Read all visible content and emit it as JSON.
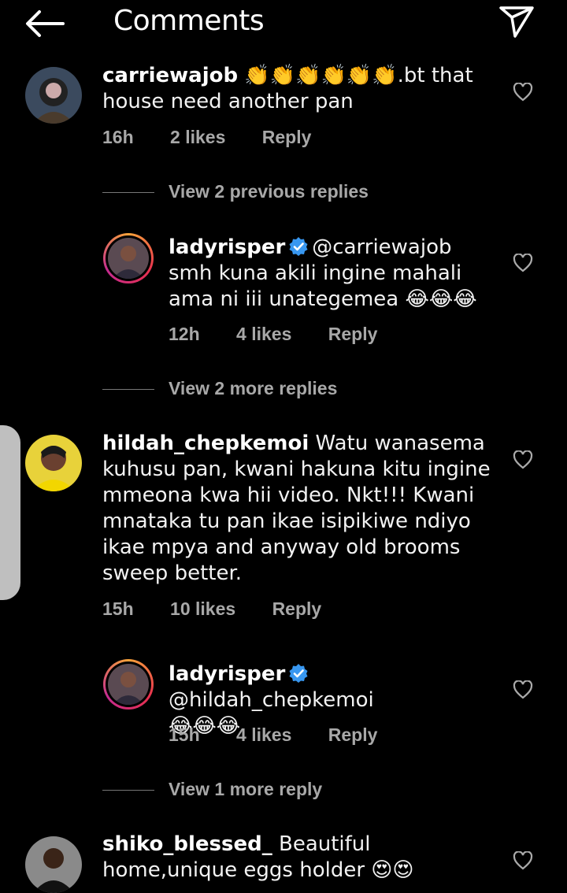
{
  "header": {
    "title": "Comments"
  },
  "comments": [
    {
      "username": "carriewajob",
      "body": "👏👏👏👏👏👏.bt that house need another pan",
      "time": "16h",
      "likes": "2 likes",
      "reply": "Reply"
    },
    {
      "view_replies": "View 2 previous replies"
    },
    {
      "username": "ladyrisper",
      "mention": "@carriewajob",
      "body": "smh kuna akili ingine mahali ama ni iii unategemea 😂😂😂",
      "time": "12h",
      "likes": "4 likes",
      "reply": "Reply"
    },
    {
      "view_replies": "View 2 more replies"
    },
    {
      "username": "hildah_chepkemoi",
      "body": "Watu wanasema kuhusu pan, kwani hakuna kitu ingine mmeona kwa hii video. Nkt!!! Kwani mnataka tu pan ikae isipikiwe ndiyo ikae mpya and anyway old brooms sweep better.",
      "time": "15h",
      "likes": "10 likes",
      "reply": "Reply"
    },
    {
      "username": "ladyrisper",
      "mention": "@hildah_chepkemoi",
      "body": "😂😂😂",
      "time": "15h",
      "likes": "4 likes",
      "reply": "Reply"
    },
    {
      "view_replies": "View 1 more reply"
    },
    {
      "username": "shiko_blessed_",
      "body": "Beautiful home,unique eggs holder 😍😍"
    }
  ],
  "icons": {
    "back": "arrow-left-icon",
    "send": "send-icon",
    "heart": "heart-icon",
    "verified": "verified-badge-icon"
  },
  "colors": {
    "background": "#000000",
    "meta": "#a8a8a8",
    "verified": "#3897f0"
  }
}
